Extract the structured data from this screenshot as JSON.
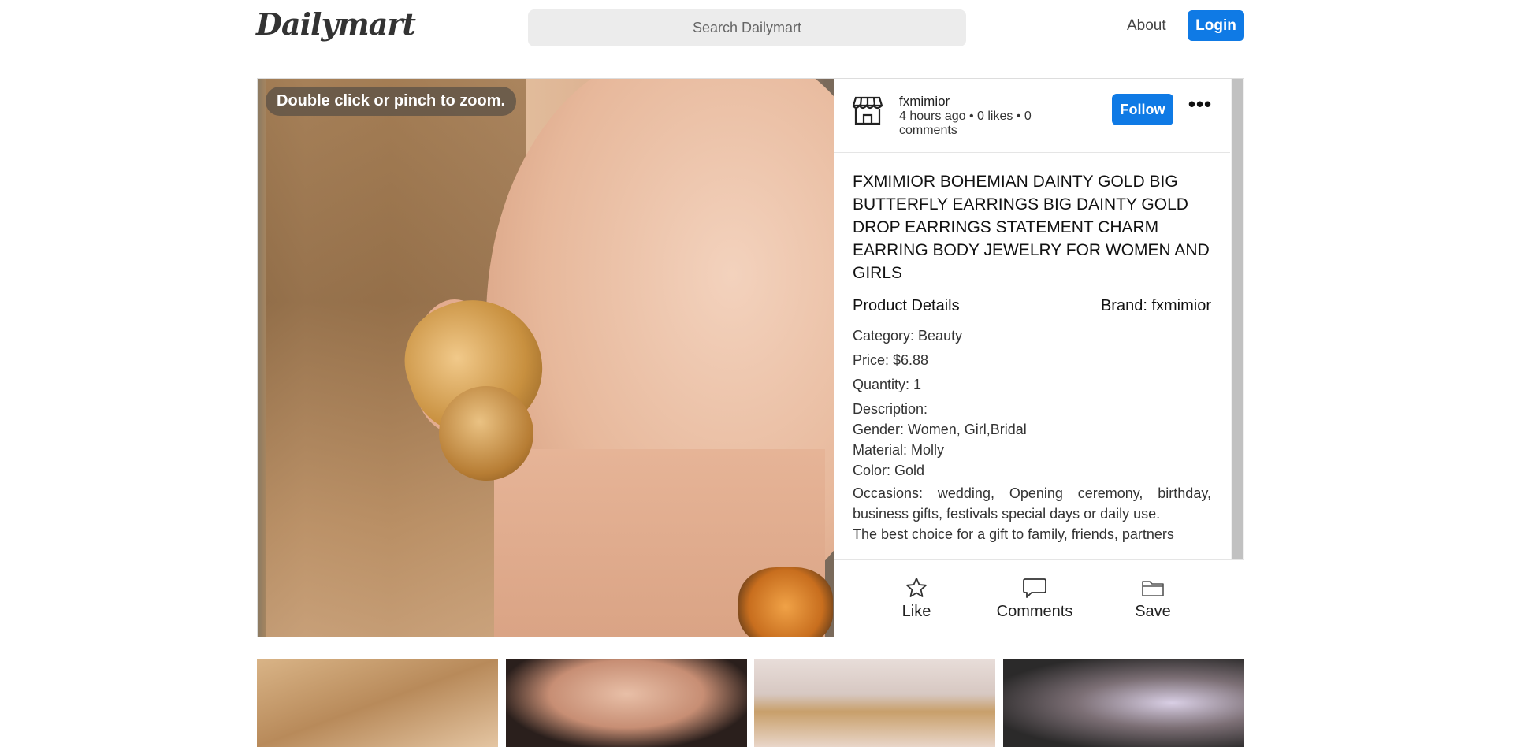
{
  "header": {
    "logo": "Dailymart",
    "search_placeholder": "Search Dailymart",
    "about": "About",
    "login": "Login"
  },
  "product": {
    "zoom_hint": "Double click or pinch to zoom.",
    "poster": {
      "name": "fxmimior",
      "meta": "4 hours ago • 0 likes • 0 comments",
      "follow": "Follow",
      "more": "•••"
    },
    "title": "FXMIMIOR BOHEMIAN DAINTY GOLD BIG BUTTERFLY EARRINGS BIG DAINTY GOLD DROP EARRINGS STATEMENT CHARM EARRING BODY JEWELRY FOR WOMEN AND GIRLS",
    "details_label": "Product Details",
    "brand": "Brand: fxmimior",
    "category": "Category: Beauty",
    "price": "Price: $6.88",
    "quantity": "Quantity: 1",
    "description_label": "Description:",
    "gender": "Gender: Women, Girl,Bridal",
    "material": "Material: Molly",
    "color": "Color: Gold",
    "occasions": "Occasions: wedding, Opening ceremony, birthday, business gifts, festivals special days or daily use.",
    "best_choice": "The best choice for a gift to family, friends, partners"
  },
  "actions": {
    "like": "Like",
    "comments": "Comments",
    "save": "Save"
  }
}
